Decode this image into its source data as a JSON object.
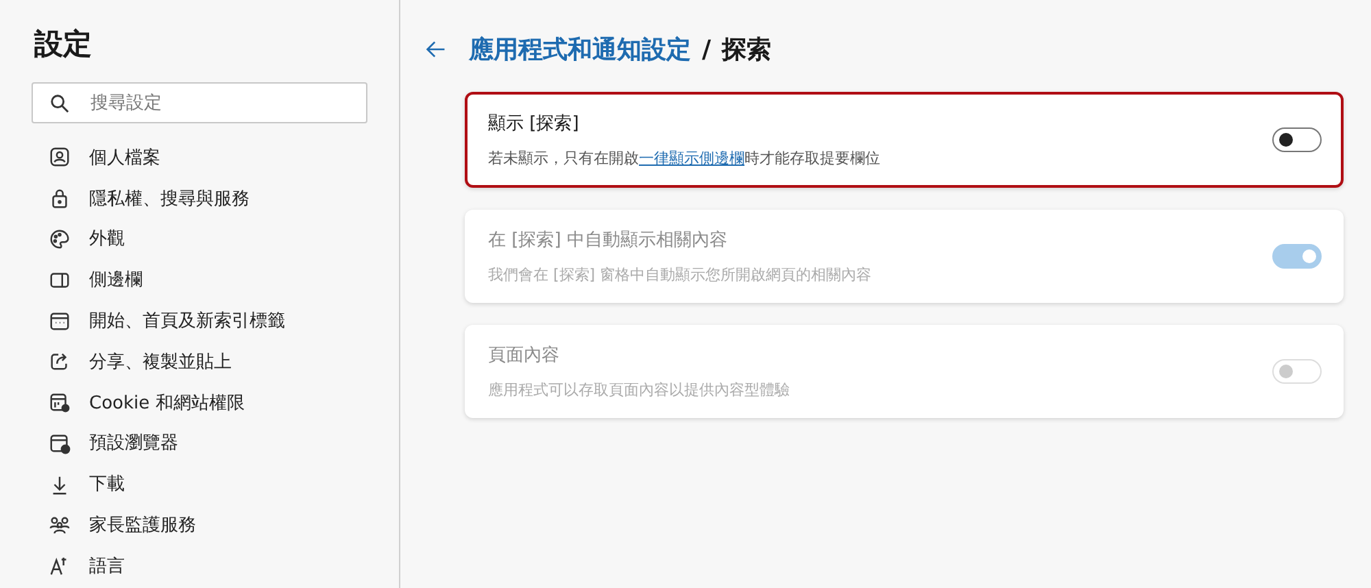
{
  "sidebar": {
    "title": "設定",
    "search": {
      "placeholder": "搜尋設定"
    },
    "items": [
      {
        "label": "個人檔案",
        "selected": false
      },
      {
        "label": "隱私權、搜尋與服務",
        "selected": false
      },
      {
        "label": "外觀",
        "selected": false
      },
      {
        "label": "側邊欄",
        "selected": false
      },
      {
        "label": "開始、首頁及新索引標籤",
        "selected": false
      },
      {
        "label": "分享、複製並貼上",
        "selected": false
      },
      {
        "label": "Cookie 和網站權限",
        "selected": false
      },
      {
        "label": "預設瀏覽器",
        "selected": false
      },
      {
        "label": "下載",
        "selected": false
      },
      {
        "label": "家長監護服務",
        "selected": false
      },
      {
        "label": "語言",
        "selected": false
      }
    ]
  },
  "header": {
    "breadcrumb": "應用程式和通知設定",
    "separator": "/",
    "current": "探索"
  },
  "settings": [
    {
      "title": "顯示 [探索]",
      "description": "若未顯示，只有在開啟",
      "link": "一律顯示側邊欄",
      "description_after": "時才能存取提要欄位",
      "on": false,
      "disabled": false,
      "highlighted": true
    },
    {
      "title": "在 [探索] 中自動顯示相關內容",
      "description": "我們會在 [探索] 窗格中自動顯示您所開啟網頁的相關內容",
      "on": true,
      "disabled": true,
      "highlighted": false
    },
    {
      "title": "頁面內容",
      "description": "應用程式可以存取頁面內容以提供內容型體驗",
      "on": false,
      "disabled": true,
      "highlighted": false
    }
  ]
}
